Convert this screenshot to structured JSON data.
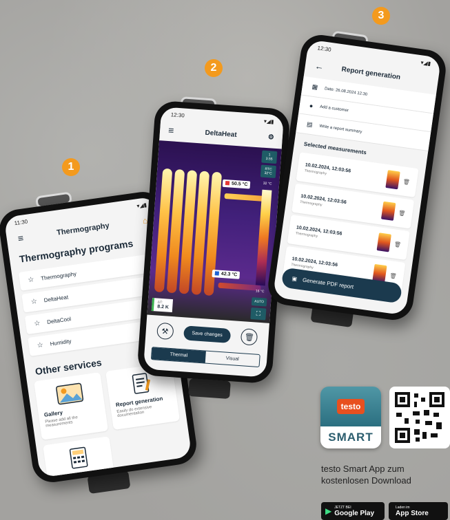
{
  "badges": [
    "1",
    "2",
    "3"
  ],
  "phone1": {
    "time": "11:30",
    "status_icons": "▾◢▮",
    "title": "Thermography",
    "programs_heading": "Thermography programs",
    "programs": [
      "Thermography",
      "DeltaHeat",
      "DeltaCool",
      "Humidity"
    ],
    "services_heading": "Other services",
    "services": [
      {
        "title": "Gallery",
        "desc": "Please add all the measurements"
      },
      {
        "title": "Report generation",
        "desc": "Easily do extensive documentation"
      }
    ]
  },
  "phone2": {
    "time": "12:30",
    "status_icons": "▾◢▮",
    "title": "DeltaHeat",
    "scale": {
      "top": "1",
      "top2": "3.55",
      "mode": "RTC",
      "max": "32°C",
      "max2": "32 °C",
      "min": "16 °C",
      "auto": "AUTO"
    },
    "hot_temp": "50.5 °C",
    "cold_temp": "42.3 °C",
    "delta_label": "ΔT:",
    "delta_value": "8.2 K",
    "save_label": "Save changes",
    "seg_thermal": "Thermal",
    "seg_visual": "Visual"
  },
  "phone3": {
    "time": "12:30",
    "status_icons": "▾◢▮",
    "title": "Report generation",
    "rows": [
      "Date: 26.08.2024 12:30",
      "Add a customer",
      "Write a report summary"
    ],
    "selected_heading": "Selected measurements",
    "measurements": [
      {
        "date": "10.02.2024, 12:03:56",
        "type": "Thermography"
      },
      {
        "date": "10.02.2024, 12:03:56",
        "type": "Thermography"
      },
      {
        "date": "10.02.2024, 12:03:56",
        "type": "Thermography"
      },
      {
        "date": "10.02.2024, 12:03:56",
        "type": "Thermography"
      }
    ],
    "generate_label": "Generate PDF report"
  },
  "promo": {
    "icon_brand": "testo",
    "icon_word": "SMART",
    "line1": "testo Smart App zum",
    "line2": "kostenlosen Download",
    "google_small": "JETZT BEI",
    "google_big": "Google Play",
    "apple_small": "Laden im",
    "apple_big": "App Store"
  },
  "colors": {
    "accent": "#f39a1e",
    "primary": "#1b3a4e",
    "testo_orange": "#e8501f"
  }
}
